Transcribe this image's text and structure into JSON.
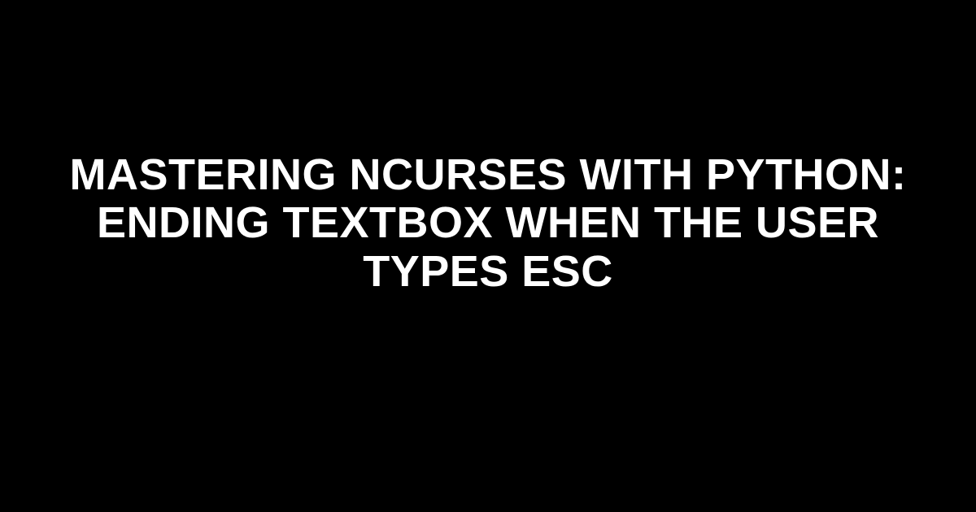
{
  "hero": {
    "title": "Mastering ncurses with Python: Ending Textbox when the User Types ESC"
  },
  "colors": {
    "background": "#000000",
    "text": "#ffffff"
  }
}
